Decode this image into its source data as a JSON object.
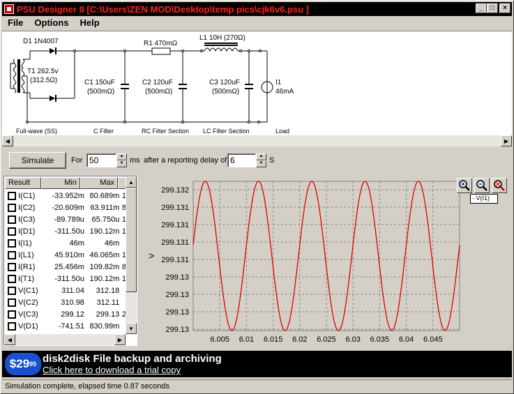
{
  "window": {
    "title": "PSU Designer II  [C:\\Users\\ZEN MOD\\Desktop\\temp pics\\cjk6v6.psu ]",
    "minimize": "_",
    "maximize": "□",
    "close": "×"
  },
  "menu": [
    "File",
    "Options",
    "Help"
  ],
  "schematic": {
    "d1": "D1 1N4007",
    "t1_line1": "T1 262.5v",
    "t1_line2": "(312.5Ω)",
    "r1": "R1 470mΩ",
    "l1": "L1 10H (270Ω)",
    "c1_line1": "C1 150uF",
    "c1_line2": "(500mΩ)",
    "c2_line1": "C2 120uF",
    "c2_line2": "(500mΩ)",
    "c3_line1": "C3 120uF",
    "c3_line2": "(500mΩ)",
    "i1_line1": "I1",
    "i1_line2": "46mA",
    "sections": [
      "Full-wave (SS)",
      "C Filter",
      "RC Filter Section",
      "LC Filter Section",
      "Load"
    ]
  },
  "controls": {
    "simulate_label": "Simulate",
    "for_label": "For",
    "duration_value": "50",
    "duration_unit": "ms",
    "delay_label": "after a reporting delay of",
    "delay_value": "6",
    "delay_unit": "S"
  },
  "results": {
    "headers": [
      "Result",
      "Min",
      "Max",
      ""
    ],
    "rows": [
      {
        "name": "I(C1)",
        "min": "-33.952m",
        "max": "80.689m",
        "extra": "1"
      },
      {
        "name": "I(C2)",
        "min": "-20.609m",
        "max": "63.911m",
        "extra": "8"
      },
      {
        "name": "I(C3)",
        "min": "-89.789u",
        "max": "65.750u",
        "extra": "1"
      },
      {
        "name": "I(D1)",
        "min": "-311.50u",
        "max": "190.12m",
        "extra": "1"
      },
      {
        "name": "I(I1)",
        "min": "46m",
        "max": "46m",
        "extra": ""
      },
      {
        "name": "I(L1)",
        "min": "45.910m",
        "max": "46.065m",
        "extra": "1"
      },
      {
        "name": "I(R1)",
        "min": "25.456m",
        "max": "109.82m",
        "extra": "8"
      },
      {
        "name": "I(T1)",
        "min": "-311.50u",
        "max": "190.12m",
        "extra": "1"
      },
      {
        "name": "V(C1)",
        "min": "311.04",
        "max": "312.18",
        "extra": ""
      },
      {
        "name": "V(C2)",
        "min": "310.98",
        "max": "312.11",
        "extra": ""
      },
      {
        "name": "V(C3)",
        "min": "299.12",
        "max": "299.13",
        "extra": "2"
      },
      {
        "name": "V(D1)",
        "min": "-741.51",
        "max": "830.99m",
        "extra": ""
      }
    ]
  },
  "chart_data": {
    "type": "line",
    "ylabel": "V",
    "xlabel": "",
    "xlim": [
      6.0,
      6.05
    ],
    "x_ticks": [
      "6.005",
      "6.01",
      "6.015",
      "6.02",
      "6.025",
      "6.03",
      "6.035",
      "6.04",
      "6.045"
    ],
    "y_ticks": [
      "299.132",
      "299.131",
      "299.131",
      "299.131",
      "299.131",
      "299.13",
      "299.13",
      "299.13",
      "299.13"
    ],
    "ylim": [
      299.1297,
      299.1323
    ],
    "grid": true,
    "series": [
      {
        "name": "V(I1)",
        "color": "#e00000",
        "period": 0.01,
        "phase_x": 6.0,
        "min": 299.1297,
        "max": 299.1323
      }
    ],
    "legend_position": "top-right"
  },
  "ad": {
    "price": "$29",
    "price_cents": "95",
    "headline": "disk2disk File backup and archiving",
    "link": "Click here to download a trial copy"
  },
  "status": "Simulation complete, elapsed time 0.87 seconds"
}
